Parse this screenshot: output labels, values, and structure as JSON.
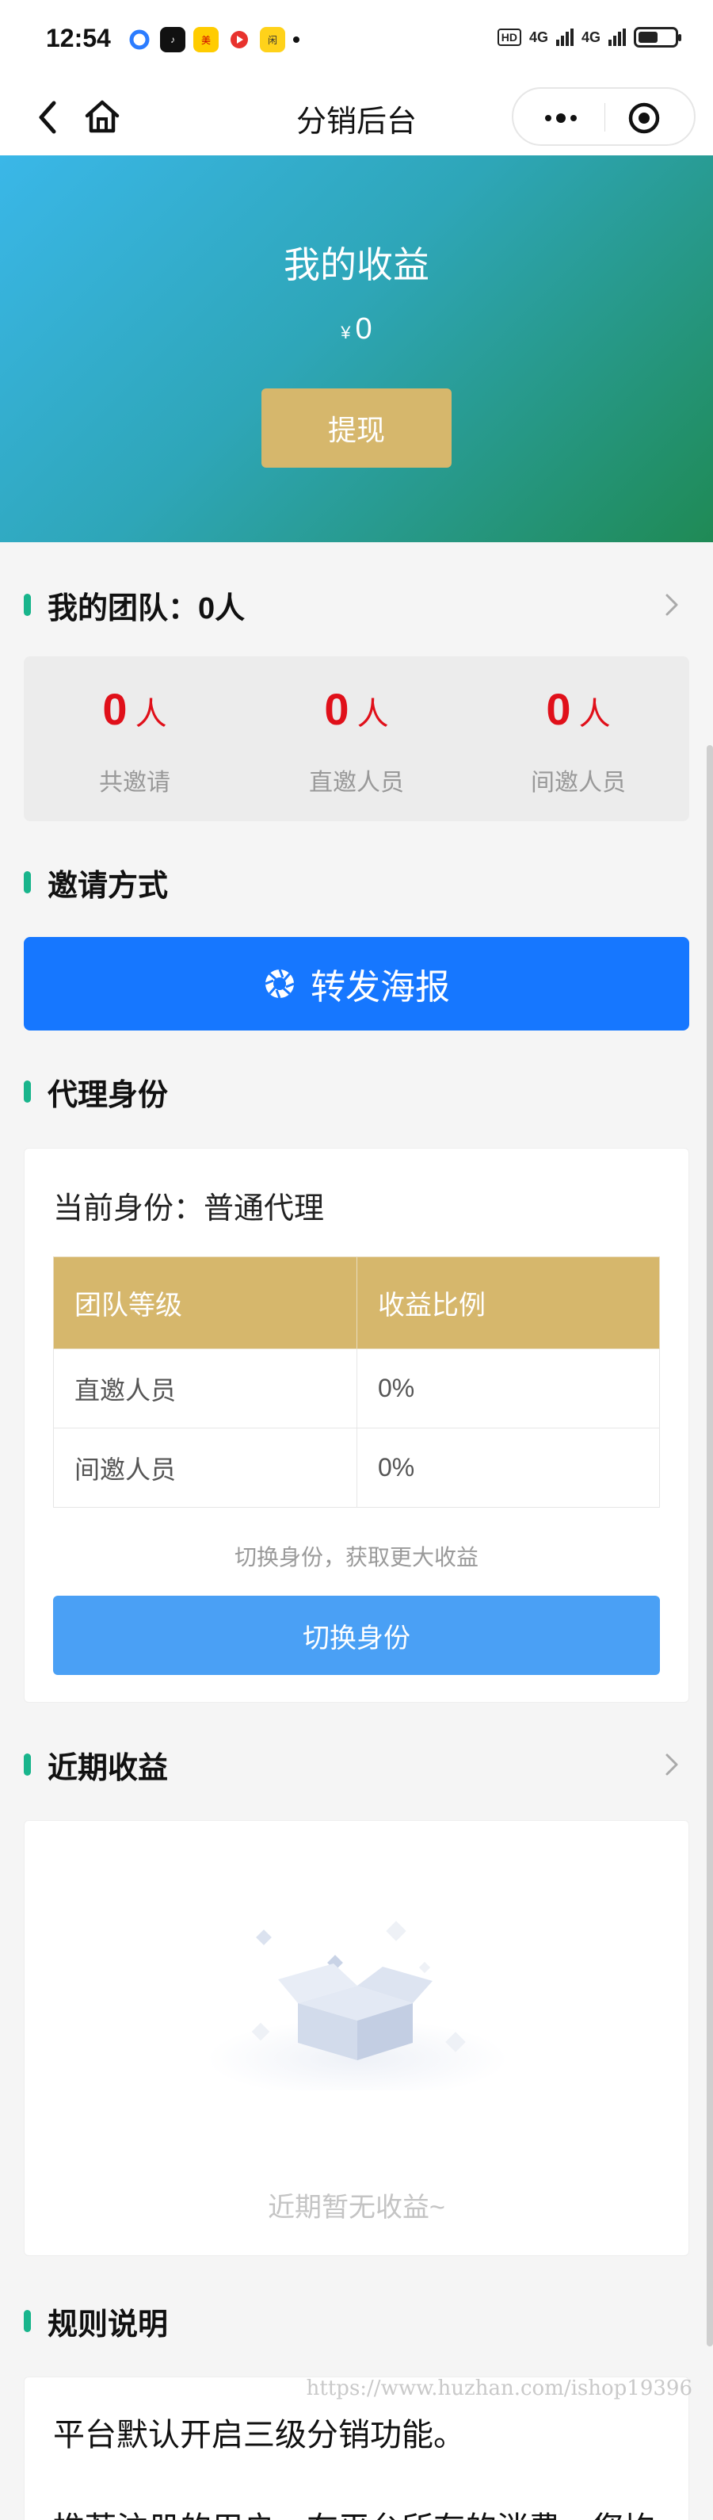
{
  "status_bar": {
    "time": "12:54",
    "network_badge": "HD",
    "signal_1": "4G",
    "signal_2": "4G"
  },
  "nav": {
    "title": "分销后台"
  },
  "hero": {
    "title": "我的收益",
    "currency": "¥",
    "amount": "0",
    "withdraw_label": "提现"
  },
  "team": {
    "title": "我的团队：",
    "count": "0人",
    "stats": [
      {
        "value": "0",
        "unit": "人",
        "label": "共邀请"
      },
      {
        "value": "0",
        "unit": "人",
        "label": "直邀人员"
      },
      {
        "value": "0",
        "unit": "人",
        "label": "间邀人员"
      }
    ]
  },
  "invite": {
    "title": "邀请方式",
    "share_label": "转发海报"
  },
  "identity": {
    "title": "代理身份",
    "current": "当前身份：普通代理",
    "table": {
      "headers": [
        "团队等级",
        "收益比例"
      ],
      "rows": [
        [
          "直邀人员",
          "0%"
        ],
        [
          "间邀人员",
          "0%"
        ]
      ]
    },
    "hint": "切换身份，获取更大收益",
    "switch_label": "切换身份"
  },
  "recent": {
    "title": "近期收益",
    "empty_text": "近期暂无收益~"
  },
  "rules": {
    "title": "规则说明",
    "line1": "平台默认开启三级分销功能。",
    "line2": "推荐注册的用户，在平台所有的消费，您均"
  },
  "watermark": "https://www.huzhan.com/ishop19396",
  "colors": {
    "accent_green": "#19b58c",
    "stat_red": "#e0101a",
    "gold": "#d6b76c",
    "share_blue": "#1677ff",
    "switch_blue": "#4aa0f5"
  }
}
